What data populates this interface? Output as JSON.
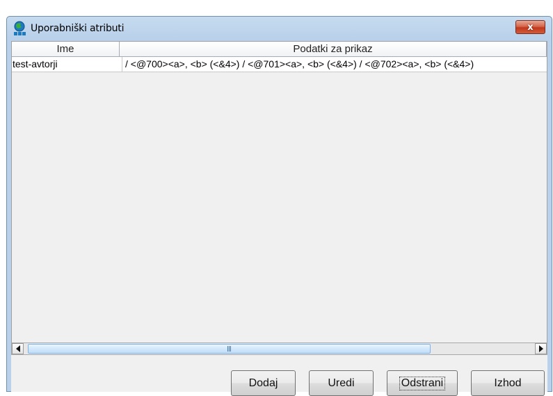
{
  "window": {
    "title": "Uporabniški atributi",
    "close_label": "x"
  },
  "table": {
    "columns": [
      "Ime",
      "Podatki za prikaz"
    ],
    "rows": [
      {
        "name": "test-avtorji",
        "display": "/ <@700><a>, <b> (<&4>) / <@701><a>, <b> (<&4>) / <@702><a>, <b> (<&4>)"
      }
    ]
  },
  "buttons": {
    "add": "Dodaj",
    "edit": "Uredi",
    "remove": "Odstrani",
    "exit": "Izhod"
  },
  "colors": {
    "title_bar": "#b9d1ea",
    "close_button": "#c1381c",
    "panel": "#f0f0f0",
    "scroll_thumb": "#c1ddf8"
  },
  "icons": [
    "app-icon",
    "close-icon",
    "scroll-left-icon",
    "scroll-right-icon"
  ]
}
